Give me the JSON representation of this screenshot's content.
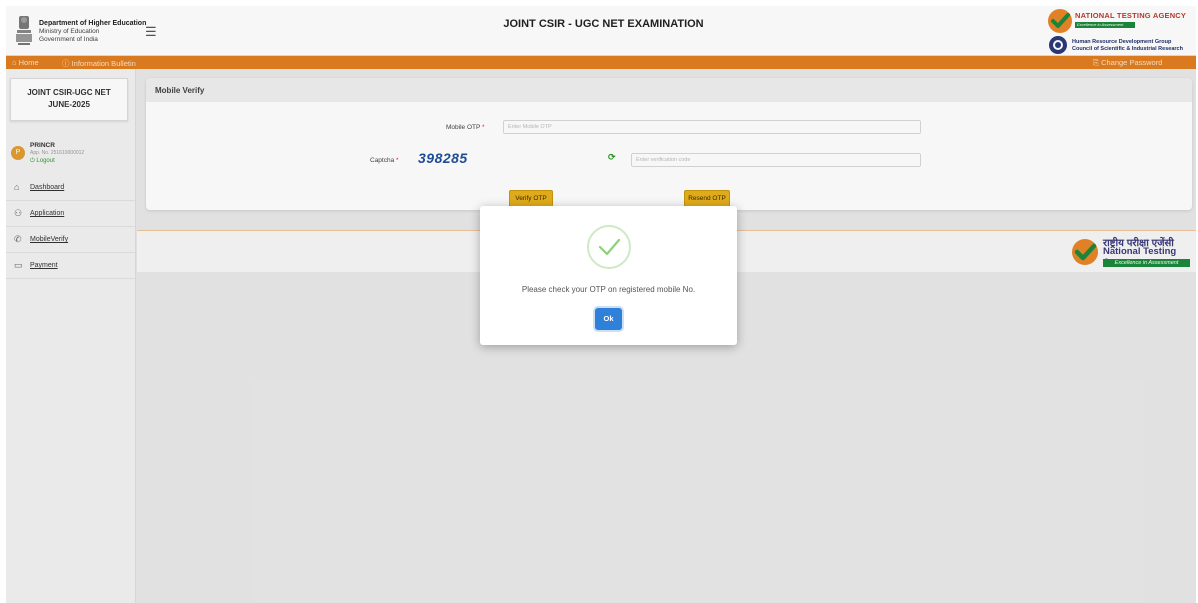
{
  "header": {
    "dept_line1": "Department of Higher Education",
    "dept_line2": "Ministry of Education",
    "dept_line3": "Government of India",
    "app_title": "JOINT CSIR - UGC NET EXAMINATION",
    "nta_name": "NATIONAL TESTING AGENCY",
    "nta_tagline": "Excellence in Assessment",
    "hrd_line1": "Human Resource Development Group",
    "hrd_line2": "Council of Scientific & Industrial Research",
    "menu_icon": "hamburger-icon"
  },
  "navbar": {
    "home": "⌂ Home",
    "info": "ⓘ Information Bulletin",
    "change_password": "⎘ Change Password",
    "color": "#e07e22"
  },
  "sidebar": {
    "exam_line1": "JOINT CSIR-UGC NET",
    "exam_line2": "JUNE-2025",
    "avatar_letter": "P",
    "user_name": "PRINCR",
    "app_no": "App. No. 251610000012",
    "logout": "⏻ Logout",
    "items": [
      {
        "icon": "⌂",
        "icon_name": "home-icon",
        "label": "Dashboard"
      },
      {
        "icon": "⚇",
        "icon_name": "user-add-icon",
        "label": "Application"
      },
      {
        "icon": "✆",
        "icon_name": "phone-icon",
        "label": "MobileVerify"
      },
      {
        "icon": "▭",
        "icon_name": "card-icon",
        "label": "Payment"
      }
    ]
  },
  "main": {
    "card_title": "Mobile Verify",
    "otp_label": "Mobile OTP",
    "otp_placeholder": "Enter Mobile OTP",
    "captcha_label": "Captcha",
    "captcha_text": "398285",
    "captcha_placeholder": "Enter verification code",
    "required_mark": "*",
    "refresh_icon": "refresh-icon",
    "verify_button": "Verify OTP",
    "resend_button": "Resend OTP"
  },
  "footer": {
    "hindi": "राष्ट्रीय परीक्षा एजेंसी",
    "english": "National Testing Agency",
    "tagline": "Excellence in Assessment"
  },
  "modal": {
    "icon": "check-circle-icon",
    "message": "Please check your OTP on registered mobile No.",
    "ok_button": "Ok"
  },
  "colors": {
    "accent_orange": "#e07e22",
    "button_yellow": "#e8b11c",
    "success_green": "#2e9b2e",
    "ok_blue": "#2f80d8"
  }
}
